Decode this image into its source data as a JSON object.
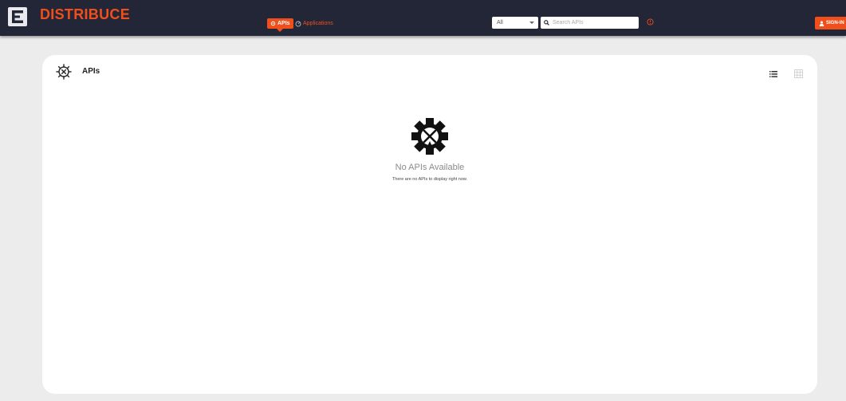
{
  "header": {
    "brand": "DISTRIBUCE",
    "tabs": [
      {
        "label": "APIs",
        "active": true,
        "icon": "gear-icon"
      },
      {
        "label": "Applications",
        "active": false,
        "icon": "gauge-icon"
      }
    ],
    "filter_select": {
      "selected": "All"
    },
    "search": {
      "placeholder": "Search APIs",
      "value": ""
    },
    "signin_label": "SIGN-IN"
  },
  "card": {
    "title": "APIs",
    "empty_state": {
      "title": "No APIs Available",
      "subtitle": "There are no APIs to display right now."
    }
  },
  "colors": {
    "accent": "#f04f1c",
    "topbar": "#232636",
    "page_bg": "#ececec",
    "card_bg": "#ffffff"
  }
}
